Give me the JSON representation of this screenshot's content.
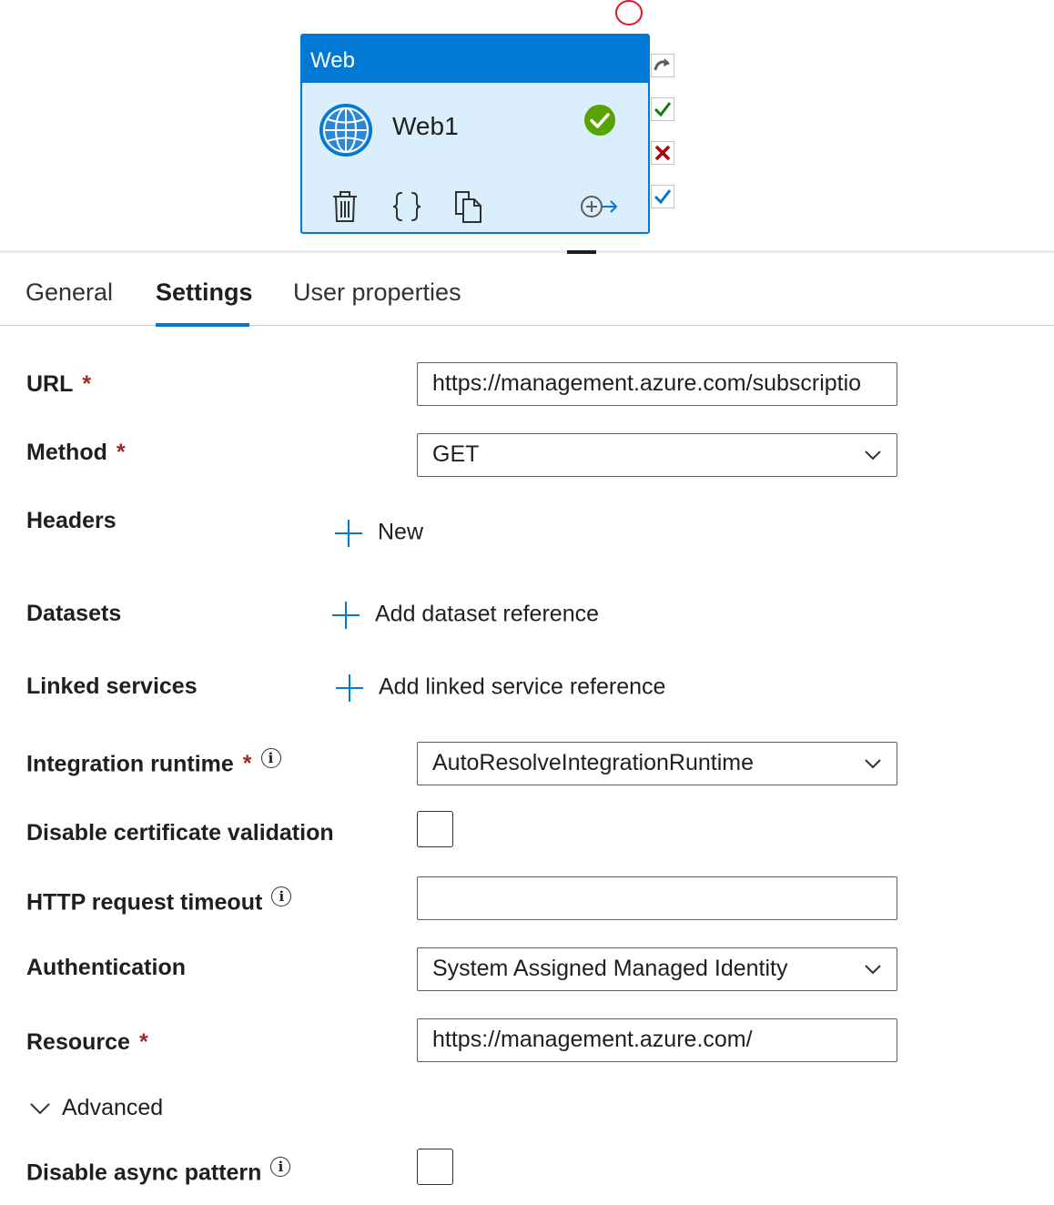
{
  "activity": {
    "type_label": "Web",
    "name": "Web1",
    "status": "valid",
    "actions": [
      "delete-icon",
      "code-icon",
      "copy-icon",
      "add-output-icon"
    ],
    "connectors": [
      "skip-icon",
      "success-icon",
      "failure-icon",
      "completion-icon"
    ]
  },
  "tabs": [
    {
      "label": "General",
      "active": false
    },
    {
      "label": "Settings",
      "active": true
    },
    {
      "label": "User properties",
      "active": false
    }
  ],
  "form": {
    "url": {
      "label": "URL",
      "required": "*",
      "value": "https://management.azure.com/subscriptio"
    },
    "method": {
      "label": "Method",
      "required": "*",
      "value": "GET"
    },
    "headers": {
      "label": "Headers",
      "add_label": "New"
    },
    "datasets": {
      "label": "Datasets",
      "add_label": "Add dataset reference"
    },
    "linked_services": {
      "label": "Linked services",
      "add_label": "Add linked service reference"
    },
    "integration_runtime": {
      "label": "Integration runtime",
      "required": "*",
      "value": "AutoResolveIntegrationRuntime"
    },
    "disable_cert": {
      "label": "Disable certificate validation",
      "checked": false
    },
    "http_timeout": {
      "label": "HTTP request timeout",
      "value": ""
    },
    "authentication": {
      "label": "Authentication",
      "value": "System Assigned Managed Identity"
    },
    "resource": {
      "label": "Resource",
      "required": "*",
      "value": "https://management.azure.com/"
    },
    "advanced": {
      "label": "Advanced",
      "expanded": true
    },
    "disable_async": {
      "label": "Disable async pattern",
      "checked": false
    }
  },
  "colors": {
    "accent": "#0078d4",
    "card_bg": "#dbeefb",
    "success": "#57a300",
    "failure": "#a80000",
    "required": "#a4262c"
  }
}
